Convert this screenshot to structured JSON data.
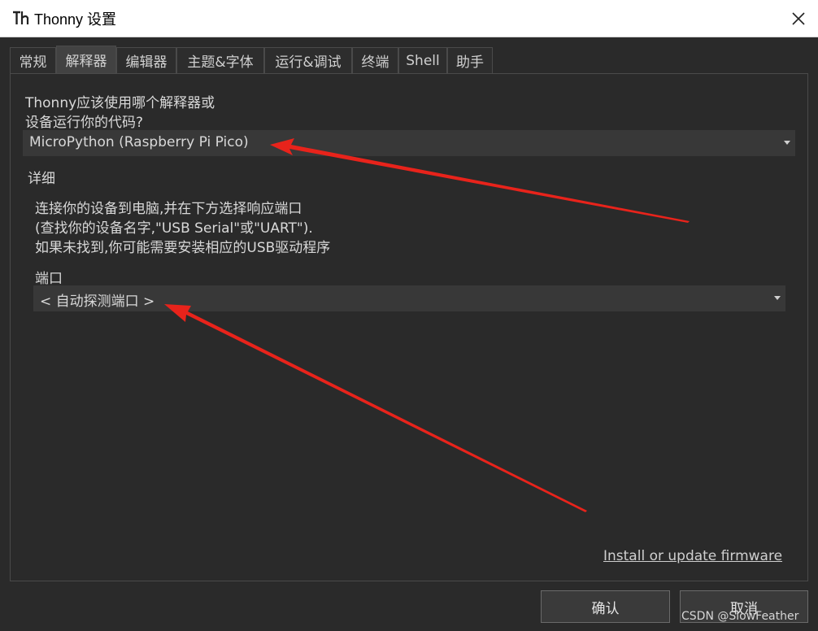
{
  "window": {
    "title": "Thonny 设置",
    "icon": "thonny-logo-icon",
    "close_icon": "close-icon"
  },
  "tabs": [
    {
      "label": "常规",
      "active": false
    },
    {
      "label": "解释器",
      "active": true
    },
    {
      "label": "编辑器",
      "active": false
    },
    {
      "label": "主题&字体",
      "active": false
    },
    {
      "label": "运行&调试",
      "active": false
    },
    {
      "label": "终端",
      "active": false
    },
    {
      "label": "Shell",
      "active": false
    },
    {
      "label": "助手",
      "active": false
    }
  ],
  "interpreter": {
    "prompt_line1": "Thonny应该使用哪个解释器或",
    "prompt_line2": "设备运行你的代码?",
    "selected": "MicroPython (Raspberry Pi Pico)"
  },
  "details": {
    "heading": "详细",
    "line1": "连接你的设备到电脑,并在下方选择响应端口",
    "line2": "(查找你的设备名字,\"USB Serial\"或\"UART\").",
    "line3": "如果未找到,你可能需要安装相应的USB驱动程序"
  },
  "port": {
    "label": "端口",
    "selected": "< 自动探测端口 >"
  },
  "firmware_link": "Install or update firmware",
  "buttons": {
    "ok": "确认",
    "cancel": "取消"
  },
  "watermark": "CSDN @SlowFeather",
  "colors": {
    "background": "#2a2a2a",
    "combo": "#383838",
    "active_tab": "#424242",
    "arrow_annotation": "#e8231b"
  }
}
